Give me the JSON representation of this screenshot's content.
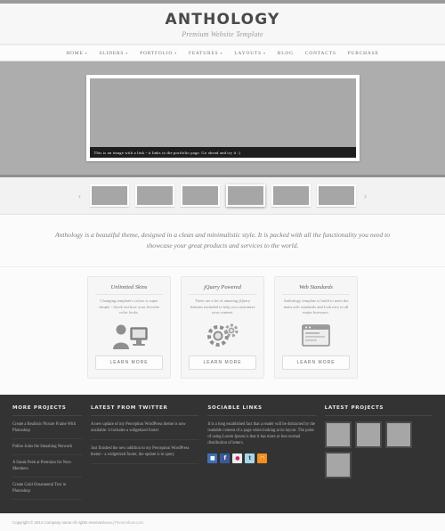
{
  "header": {
    "logo": "ANTHOLOGY",
    "tagline": "Premium Website Template"
  },
  "nav": {
    "items": [
      {
        "label": "HOME",
        "has_caret": true
      },
      {
        "label": "SLIDERS",
        "has_caret": true
      },
      {
        "label": "PORTFOLIO",
        "has_caret": true
      },
      {
        "label": "FEATURES",
        "has_caret": true
      },
      {
        "label": "LAYOUTS",
        "has_caret": true
      },
      {
        "label": "BLOG",
        "has_caret": false
      },
      {
        "label": "CONTACTS",
        "has_caret": false
      },
      {
        "label": "PURCHASE",
        "has_caret": false
      }
    ],
    "caret_glyph": "▾"
  },
  "slider": {
    "caption": "This is an image with a link - it links to the portfolio page. Go ahead and try it :)"
  },
  "carousel": {
    "prev_glyph": "‹",
    "next_glyph": "›",
    "thumbs": [
      {
        "active": false
      },
      {
        "active": false
      },
      {
        "active": false
      },
      {
        "active": true
      },
      {
        "active": false
      },
      {
        "active": false
      }
    ]
  },
  "intro": {
    "text": "Anthology is a beautiful theme, designed in a clean and minimalistic style. It is packed with all the functionality you need to showcase your great products and services to the world."
  },
  "features": {
    "boxes": [
      {
        "title": "Unlimited Skins",
        "text": "Changing template's colors is super simple - check out how your favorite color looks.",
        "icon": "person-at-computer-icon",
        "button": "LEARN MORE"
      },
      {
        "title": "jQuery Powered",
        "text": "There are a lot of amazing jQuery features included to help you customize your content.",
        "icon": "gears-cog-icon",
        "button": "LEARN MORE"
      },
      {
        "title": "Web Standards",
        "text": "Anthology template is build to meet the main web standards and look nice in all major browsers.",
        "icon": "browser-window-icon",
        "button": "LEARN MORE"
      }
    ]
  },
  "footer": {
    "projects": {
      "title": "MORE PROJECTS",
      "links": [
        "Create a Realistic Picture Frame With Photoshop",
        "Pulloo Joins the Smashing Network",
        "A Sneak Peek at Premium for Non-Members",
        "Create Gold Ornamental Text in Photoshop"
      ]
    },
    "twitter": {
      "title": "LATEST FROM TWITTER",
      "tweets": [
        "A new update of my Perception WordPress theme is now available: it includes a widgetized footer",
        "Just finished the new addition to my Perception WordPress theme - a widgetized footer, the update is in query"
      ]
    },
    "sociable": {
      "title": "SOCIABLE LINKS",
      "text": "It is a long established fact that a reader will be distracted by the readable content of a page when looking at its layout. The point of using Lorem Ipsum is that it has more or less normal distribution of letters.",
      "icons": [
        {
          "name": "delicious-icon",
          "glyph": "■",
          "color": "#3b5998"
        },
        {
          "name": "facebook-icon",
          "glyph": "f",
          "color": "#3b5998"
        },
        {
          "name": "flickr-icon",
          "glyph": "●",
          "color": "#e8e8e8"
        },
        {
          "name": "twitter-icon",
          "glyph": "t",
          "color": "#9fd6e8"
        },
        {
          "name": "rss-icon",
          "glyph": "◠",
          "color": "#f09022"
        }
      ]
    },
    "latest_projects": {
      "title": "LATEST PROJECTS",
      "thumbs": [
        1,
        2,
        3,
        4
      ]
    }
  },
  "copyright": {
    "text": "Copyright © 2014 Company name All rights reserved ",
    "link": "www.jThemeshow.com"
  }
}
